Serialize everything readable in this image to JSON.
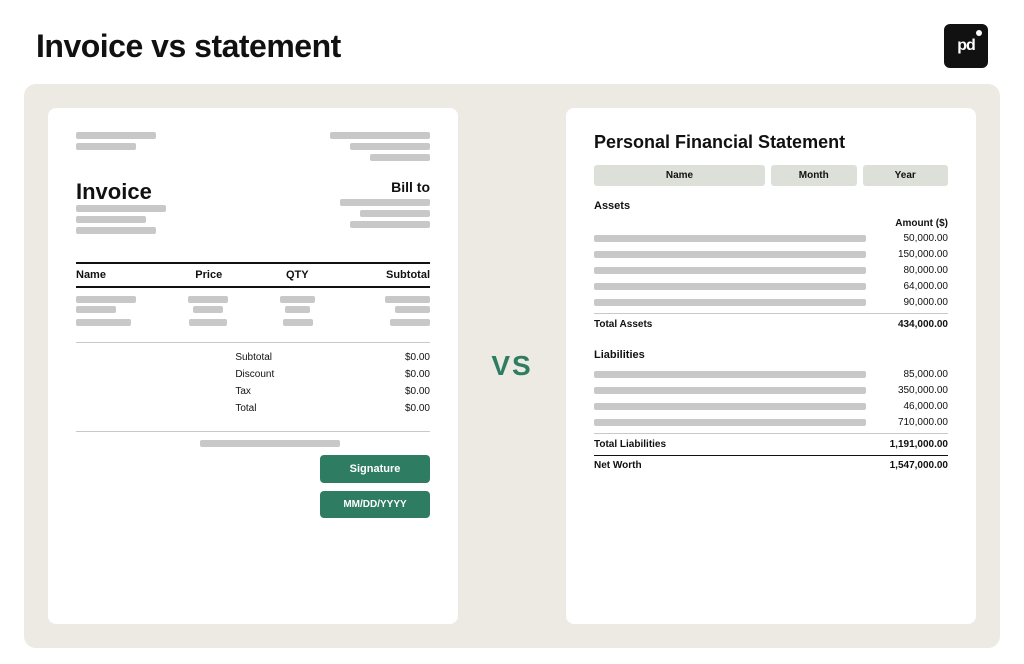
{
  "page": {
    "title": "Invoice vs statement",
    "logo_text": "pd"
  },
  "invoice": {
    "title": "Invoice",
    "bill_to": "Bill to",
    "table_headers": [
      "Name",
      "Price",
      "QTY",
      "Subtotal"
    ],
    "totals": [
      {
        "label": "Subtotal",
        "value": "$0.00"
      },
      {
        "label": "Discount",
        "value": "$0.00"
      },
      {
        "label": "Tax",
        "value": "$0.00"
      },
      {
        "label": "Total",
        "value": "$0.00"
      }
    ],
    "signature_btn": "Signature",
    "date_btn": "MM/DD/YYYY"
  },
  "vs_label": "VS",
  "statement": {
    "title": "Personal Financial Statement",
    "fields": {
      "name": "Name",
      "month": "Month",
      "year": "Year"
    },
    "assets_label": "Assets",
    "amount_header": "Amount ($)",
    "assets": [
      {
        "amount": "50,000.00"
      },
      {
        "amount": "150,000.00"
      },
      {
        "amount": "80,000.00"
      },
      {
        "amount": "64,000.00"
      },
      {
        "amount": "90,000.00"
      }
    ],
    "total_assets_label": "Total Assets",
    "total_assets_value": "434,000.00",
    "liabilities_label": "Liabilities",
    "liabilities": [
      {
        "amount": "85,000.00"
      },
      {
        "amount": "350,000.00"
      },
      {
        "amount": "46,000.00"
      },
      {
        "amount": "710,000.00"
      }
    ],
    "total_liabilities_label": "Total Liabilities",
    "total_liabilities_value": "1,191,000.00",
    "net_worth_label": "Net Worth",
    "net_worth_value": "1,547,000.00"
  }
}
